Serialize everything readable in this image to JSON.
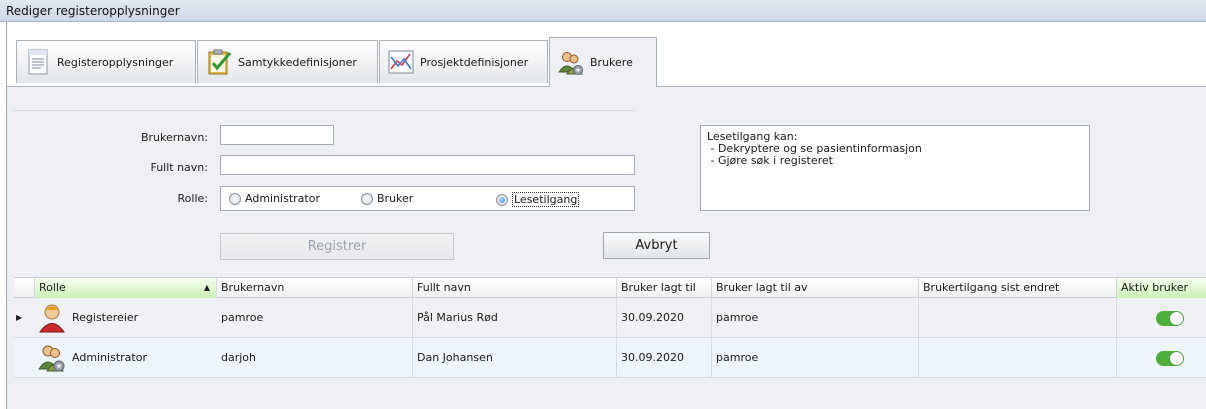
{
  "window": {
    "title": "Rediger registeropplysninger"
  },
  "tabs": [
    {
      "label": "Registeropplysninger",
      "icon": "document-icon",
      "active": false
    },
    {
      "label": "Samtykkedefinisjoner",
      "icon": "clipboard-check-icon",
      "active": false
    },
    {
      "label": "Prosjektdefinisjoner",
      "icon": "chart-icon",
      "active": false
    },
    {
      "label": "Brukere",
      "icon": "users-gear-icon",
      "active": true
    }
  ],
  "form": {
    "username_label": "Brukernavn:",
    "username_value": "",
    "fullname_label": "Fullt navn:",
    "fullname_value": "",
    "role_label": "Rolle:",
    "roles": [
      {
        "label": "Administrator",
        "selected": false
      },
      {
        "label": "Bruker",
        "selected": false
      },
      {
        "label": "Lesetilgang",
        "selected": true
      }
    ],
    "info_lines": [
      "Lesetilgang kan:",
      " - Dekryptere og se pasientinformasjon",
      " - Gjøre søk i registeret"
    ],
    "register_button": "Registrer",
    "cancel_button": "Avbryt"
  },
  "grid": {
    "columns": [
      "Rolle",
      "Brukernavn",
      "Fullt navn",
      "Bruker lagt til",
      "Bruker lagt til av",
      "Brukertilgang sist endret",
      "Aktiv bruker"
    ],
    "rows": [
      {
        "role": "Registereier",
        "avatar": "owner-avatar-icon",
        "username": "pamroe",
        "fullname": "Pål Marius Rød",
        "added": "30.09.2020",
        "added_by": "pamroe",
        "changed": "",
        "active": true
      },
      {
        "role": "Administrator",
        "avatar": "admin-avatar-icon",
        "username": "darjoh",
        "fullname": "Dan Johansen",
        "added": "30.09.2020",
        "added_by": "pamroe",
        "changed": "",
        "active": true
      }
    ]
  },
  "colors": {
    "toggle_on": "#4caf3c",
    "sorted_header": "#c9f0b2",
    "titlebar": "#ccd7e6"
  }
}
